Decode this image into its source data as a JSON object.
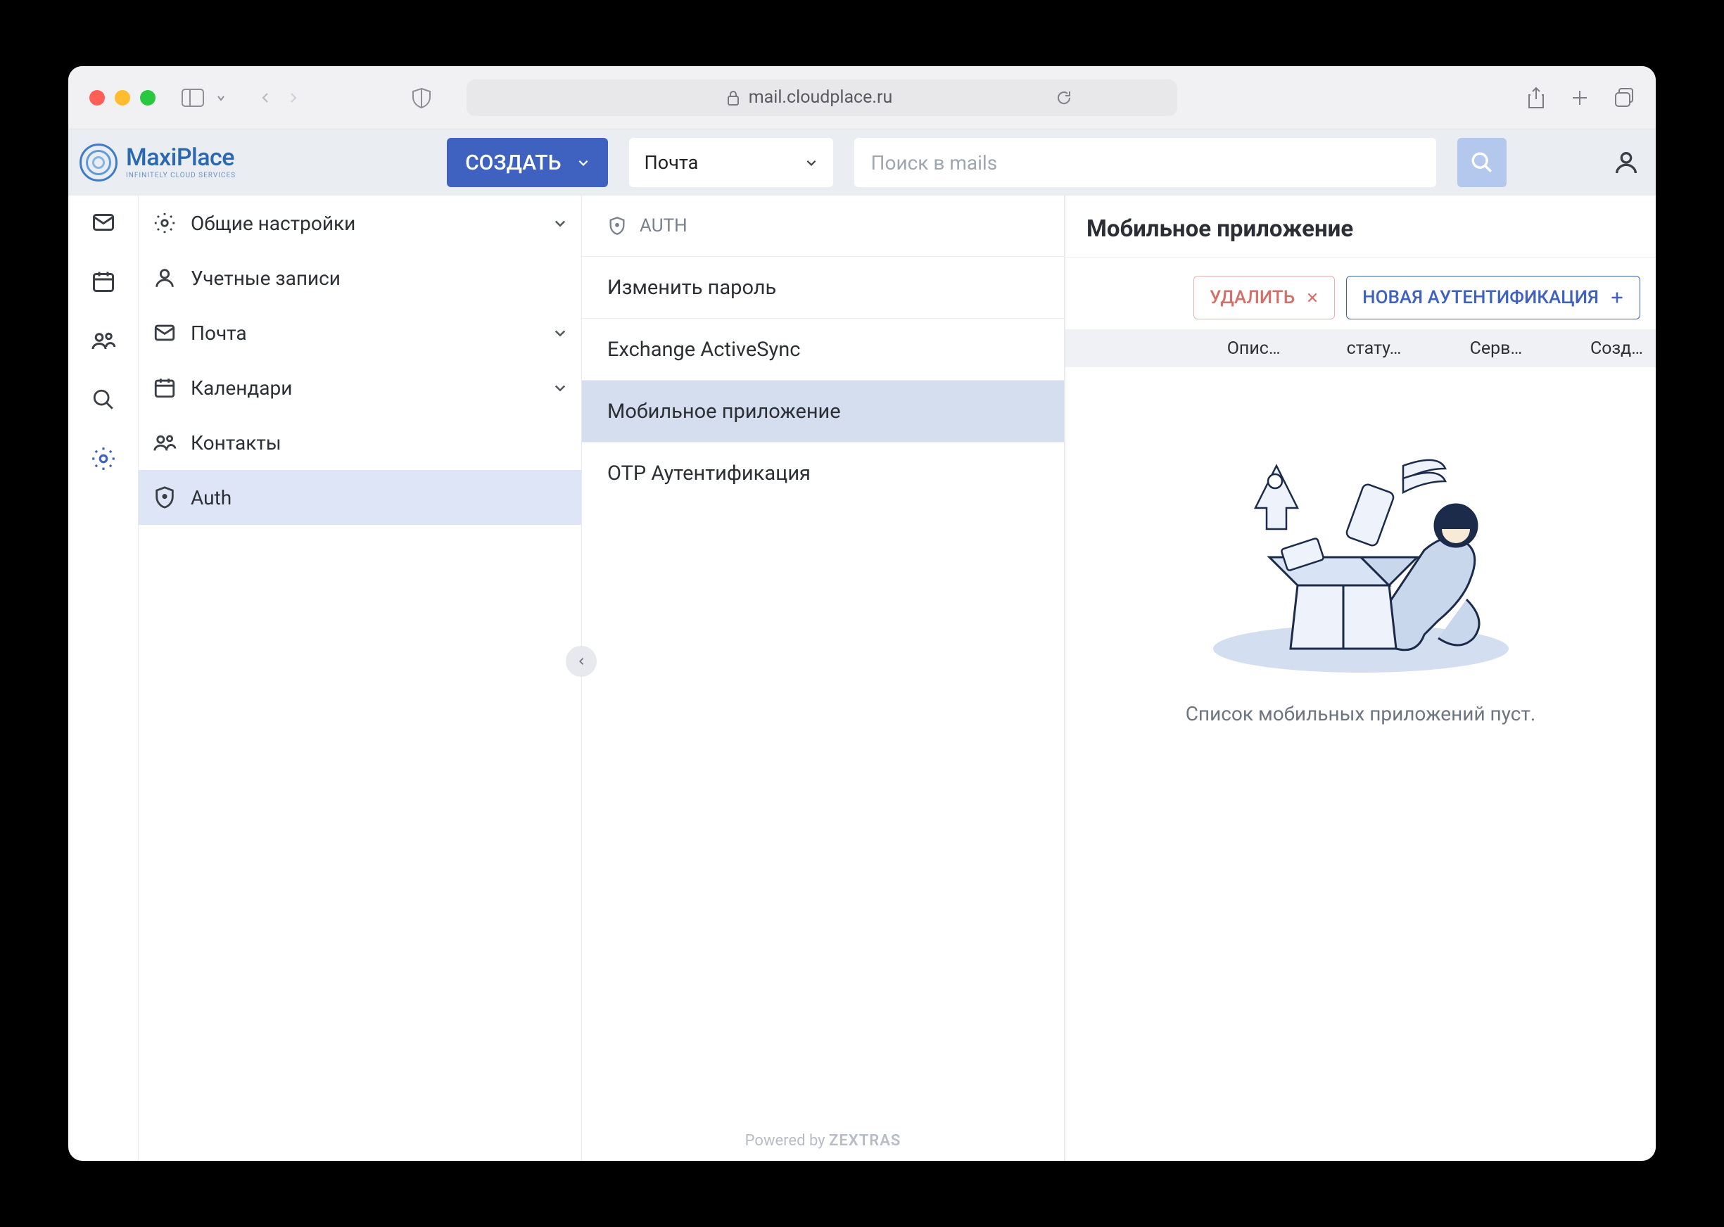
{
  "browser": {
    "url_host": "mail.cloudplace.ru"
  },
  "brand": {
    "name": "MaxiPlace",
    "tagline": "INFINITELY CLOUD SERVICES"
  },
  "header": {
    "create_label": "СОЗДАТЬ",
    "scope_selected": "Почта",
    "search_placeholder": "Поиск в mails"
  },
  "sidebar": {
    "items": [
      {
        "id": "general",
        "label": "Общие настройки",
        "has_chevron": true
      },
      {
        "id": "accounts",
        "label": "Учетные записи",
        "has_chevron": false
      },
      {
        "id": "mail",
        "label": "Почта",
        "has_chevron": true
      },
      {
        "id": "calendar",
        "label": "Календари",
        "has_chevron": true
      },
      {
        "id": "contacts",
        "label": "Контакты",
        "has_chevron": false
      },
      {
        "id": "auth",
        "label": "Auth",
        "has_chevron": false
      }
    ]
  },
  "auth_panel": {
    "header": "AUTH",
    "items": [
      {
        "label": "Изменить пароль"
      },
      {
        "label": "Exchange ActiveSync"
      },
      {
        "label": "Мобильное приложение"
      },
      {
        "label": "OTP Аутентификация"
      }
    ],
    "powered_prefix": "Powered by ",
    "powered_brand": "ZEXTRAS"
  },
  "content": {
    "title": "Мобильное приложение",
    "delete_label": "УДАЛИТЬ",
    "new_auth_label": "НОВАЯ АУТЕНТИФИКАЦИЯ",
    "columns": [
      "Опис…",
      "стату…",
      "Серв…",
      "Созд…"
    ],
    "empty_text": "Список мобильных приложений пуст."
  }
}
